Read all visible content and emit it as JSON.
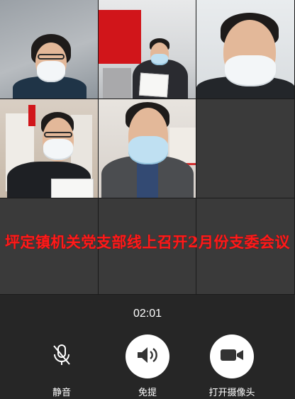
{
  "call": {
    "caption": "坪定镇机关党支部线上召开2月份支委会议",
    "timer": "02:01"
  },
  "controls": [
    {
      "label": "静音",
      "icon": "microphone-muted-icon"
    },
    {
      "label": "免提",
      "icon": "speaker-icon"
    },
    {
      "label": "打开摄像头",
      "icon": "video-camera-icon"
    }
  ],
  "colors": {
    "caption": "#ff1a1a",
    "background": "#262626",
    "button": "#ffffff"
  }
}
